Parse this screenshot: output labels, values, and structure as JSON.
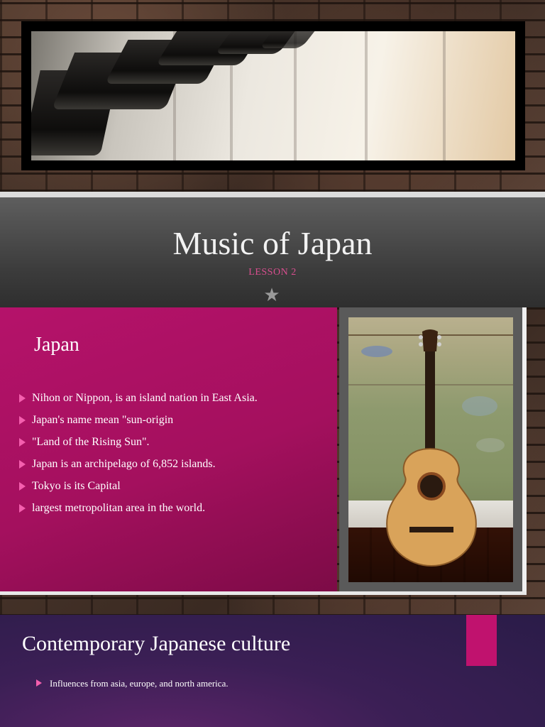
{
  "slide1": {
    "title": "Music of Japan",
    "subtitle": "LESSON 2",
    "star_icon": "star-icon",
    "image": "piano-keys-photo"
  },
  "slide2": {
    "heading": "Japan",
    "bullets": [
      "Nihon or Nippon, is an island nation in East Asia.",
      "Japan's name mean \"sun-origin",
      " \"Land of the Rising Sun\".",
      "Japan is an archipelago of 6,852 islands.",
      "Tokyo is its Capital",
      "largest metropolitan area in the world."
    ],
    "image": "acoustic-guitar-photo",
    "accent_color": "#b5126a"
  },
  "slide3": {
    "heading": "Contemporary Japanese culture",
    "bullets": [
      "Influences from asia, europe, and north america."
    ],
    "accent_color": "#c0126e"
  }
}
